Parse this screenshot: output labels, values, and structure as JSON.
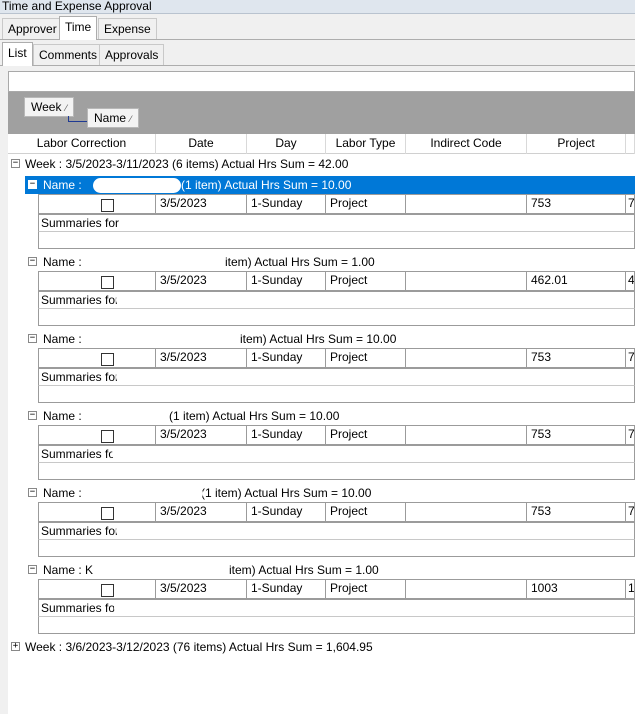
{
  "window": {
    "title": "Time and Expense Approval"
  },
  "top_tabs": [
    {
      "label": "Approver",
      "active": false
    },
    {
      "label": "Time",
      "active": true
    },
    {
      "label": "Expense",
      "active": false
    }
  ],
  "sub_tabs": [
    {
      "label": "List",
      "active": true
    },
    {
      "label": "Comments",
      "active": false
    },
    {
      "label": "Approvals",
      "active": false
    }
  ],
  "group_panel": {
    "chips": [
      {
        "label": "Week"
      },
      {
        "label": "Name"
      }
    ],
    "sort_glyph": "⁄"
  },
  "columns": [
    "Labor Correction",
    "Date",
    "Day",
    "Labor Type",
    "Indirect Code",
    "Project",
    ""
  ],
  "groups": {
    "week1": {
      "label": "Week : 3/5/2023-3/11/2023 (6 items) Actual Hrs Sum = 42.00",
      "expanded": true
    },
    "employees": [
      {
        "header_prefix": "Name :",
        "header_suffix": "(1 item) Actual Hrs Sum = 10.00",
        "selected": true,
        "row": {
          "date": "3/5/2023",
          "day": "1-Sunday",
          "labor_type": "Project",
          "indirect_code": "",
          "project": "753",
          "extra": "7"
        },
        "summary": "Summaries for"
      },
      {
        "header_prefix": "Name :",
        "header_suffix": "item) Actual Hrs Sum = 1.00",
        "selected": false,
        "row": {
          "date": "3/5/2023",
          "day": "1-Sunday",
          "labor_type": "Project",
          "indirect_code": "",
          "project": "462.01",
          "extra": "4"
        },
        "summary": "Summaries for"
      },
      {
        "header_prefix": "Name :",
        "header_suffix": "item) Actual Hrs Sum = 10.00",
        "selected": false,
        "row": {
          "date": "3/5/2023",
          "day": "1-Sunday",
          "labor_type": "Project",
          "indirect_code": "",
          "project": "753",
          "extra": "7"
        },
        "summary": "Summaries for"
      },
      {
        "header_prefix": "Name :",
        "header_suffix": "(1 item) Actual Hrs Sum = 10.00",
        "selected": false,
        "row": {
          "date": "3/5/2023",
          "day": "1-Sunday",
          "labor_type": "Project",
          "indirect_code": "",
          "project": "753",
          "extra": "7"
        },
        "summary": "Summaries for"
      },
      {
        "header_prefix": "Name :",
        "header_suffix": "(1 item) Actual Hrs Sum = 10.00",
        "selected": false,
        "row": {
          "date": "3/5/2023",
          "day": "1-Sunday",
          "labor_type": "Project",
          "indirect_code": "",
          "project": "753",
          "extra": "7"
        },
        "summary": "Summaries for"
      },
      {
        "header_prefix": "Name : K",
        "header_suffix": "item) Actual Hrs Sum = 1.00",
        "selected": false,
        "row": {
          "date": "3/5/2023",
          "day": "1-Sunday",
          "labor_type": "Project",
          "indirect_code": "",
          "project": "1003",
          "extra": "1"
        },
        "summary": "Summaries for"
      }
    ],
    "week2": {
      "label": "Week : 3/6/2023-3/12/2023 (76 items) Actual Hrs Sum = 1,604.95",
      "expanded": false
    }
  },
  "expander_glyphs": {
    "expanded": "−",
    "collapsed": "+"
  },
  "colors": {
    "selection": "#0078d7",
    "group_panel": "#a0a0a0"
  }
}
